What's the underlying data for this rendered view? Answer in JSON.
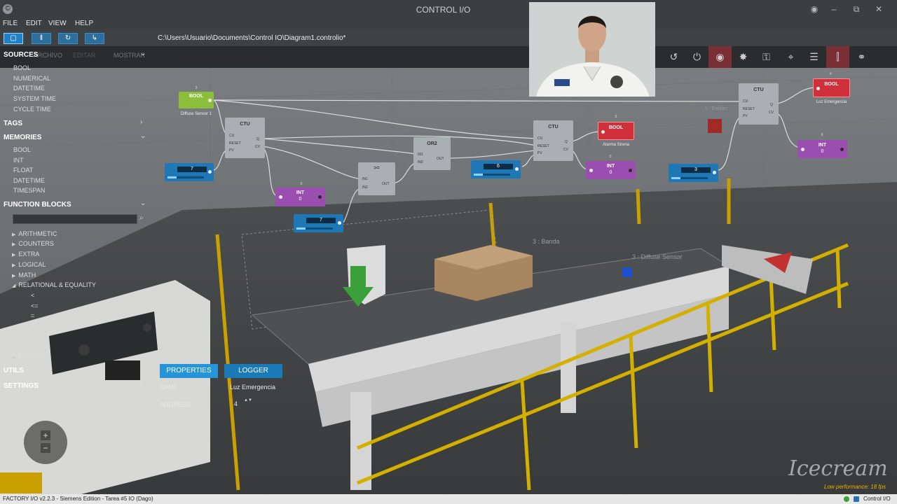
{
  "window": {
    "title": "CONTROL I/O",
    "app_icon_glyph": "©",
    "controls": {
      "eye": "◉",
      "minimize": "–",
      "restore": "⧉",
      "close": "✕"
    }
  },
  "menu": {
    "file": "FILE",
    "edit": "EDIT",
    "view": "VIEW",
    "help": "HELP"
  },
  "toolbar": {
    "file_path": "C:\\Users\\Usuario\\Documents\\Control IO\\Diagram1.controlio*",
    "mode_buttons": [
      "edit-mode",
      "pause",
      "reset",
      "step"
    ],
    "mode_glyphs": [
      "▢",
      "‖",
      "↻",
      "↳"
    ]
  },
  "scene_tabs": {
    "archivo": "ARCHIVO",
    "editar": "EDITAR",
    "mostrar": "MOSTRAR"
  },
  "right_tools": [
    "reset-icon",
    "power-icon",
    "record-icon",
    "sensor-icon",
    "lock-icon",
    "target-icon",
    "list-icon",
    "io-icon",
    "link-icon"
  ],
  "right_tool_glyphs": [
    "↺",
    "⏻",
    "◉",
    "✸",
    "⚿",
    "⌖",
    "☰",
    "⫿",
    "⚭"
  ],
  "palette": {
    "sources": {
      "label": "SOURCES",
      "items": [
        "BOOL",
        "NUMERICAL",
        "DATETIME",
        "SYSTEM TIME",
        "CYCLE TIME"
      ]
    },
    "tags": {
      "label": "TAGS"
    },
    "memories": {
      "label": "MEMORIES",
      "items": [
        "BOOL",
        "INT",
        "FLOAT",
        "DATETIME",
        "TIMESPAN"
      ]
    },
    "function_blocks": {
      "label": "FUNCTION BLOCKS",
      "groups": [
        "ARITHMETIC",
        "COUNTERS",
        "EXTRA",
        "LOGICAL",
        "MATH",
        "RELATIONAL & EQUALITY"
      ],
      "relational_items": [
        "<",
        "<=",
        "=",
        "≠",
        ">",
        ">="
      ],
      "timers": "TIMERS"
    },
    "utils": {
      "label": "UTILS"
    },
    "settings": {
      "label": "SETTINGS"
    },
    "chevron_down": "⌄",
    "chevron_right": "›",
    "tree_closed": "▶",
    "tree_open": "◢",
    "search_glyph": "⌕"
  },
  "diagram": {
    "bool_sensor": {
      "title": "BOOL",
      "address": "3",
      "caption": "Diffuse Sensor 1"
    },
    "ctu_1": {
      "title": "CTU",
      "ports_in": [
        "CU",
        "RESET",
        "PV"
      ],
      "ports_out": [
        "Q",
        "CV"
      ]
    },
    "ctu_2": {
      "title": "CTU",
      "ports_in": [
        "CU",
        "RESET",
        "PV"
      ],
      "ports_out": [
        "Q",
        "CV"
      ]
    },
    "ctu_3": {
      "title": "CTU",
      "ports_in": [
        "CU",
        "RESET",
        "PV"
      ],
      "ports_out": [
        "Q",
        "CV"
      ]
    },
    "const_7a": {
      "value": "7"
    },
    "const_7b": {
      "value": "7"
    },
    "const_6": {
      "value": "6"
    },
    "const_3": {
      "value": "3"
    },
    "int_1": {
      "title": "INT",
      "value": "0",
      "address": "0"
    },
    "int_2": {
      "title": "INT",
      "value": "0",
      "address": "0"
    },
    "int_3": {
      "title": "INT",
      "value": "0",
      "address": "0"
    },
    "ge_block": {
      "title": ">=",
      "ports_in": [
        "IN1",
        "IN2"
      ],
      "port_out": "OUT"
    },
    "or_block": {
      "title": "OR2",
      "ports_in": [
        "IN1",
        "IN2"
      ],
      "port_out": "OUT"
    },
    "bool_sirena": {
      "title": "BOOL",
      "address": "5",
      "caption": "Alarma Sirena"
    },
    "bool_luz": {
      "title": "BOOL",
      "address": "4",
      "caption": "Luz Emergencia"
    }
  },
  "scene_labels": {
    "banda": "3 : Banda",
    "diffuse": "3 : Diffuse Sensor",
    "emitter": "1 : Emitter"
  },
  "properties": {
    "tab_properties": "PROPERTIES",
    "tab_logger": "LOGGER",
    "name_label": "NAME",
    "name_value": "Luz Emergencia",
    "address_label": "ADDRESS",
    "address_value": "4",
    "spin_glyphs": "▲▼"
  },
  "nav": {
    "zoom_in": "+",
    "zoom_out": "−"
  },
  "status": {
    "left": "FACTORY I/O v2.2.3 - Siemens Edition - Tarea #5 IO  (Dago)",
    "right": "Control I/O",
    "performance": "Low performance: 18 fps"
  },
  "watermark": "Icecream",
  "colors": {
    "accent_blue": "#2594d8",
    "bool_green": "#8bbf3b",
    "bool_red": "#d0303a",
    "int_purple": "#9a4fb0",
    "const_blue": "#1f78b6"
  }
}
